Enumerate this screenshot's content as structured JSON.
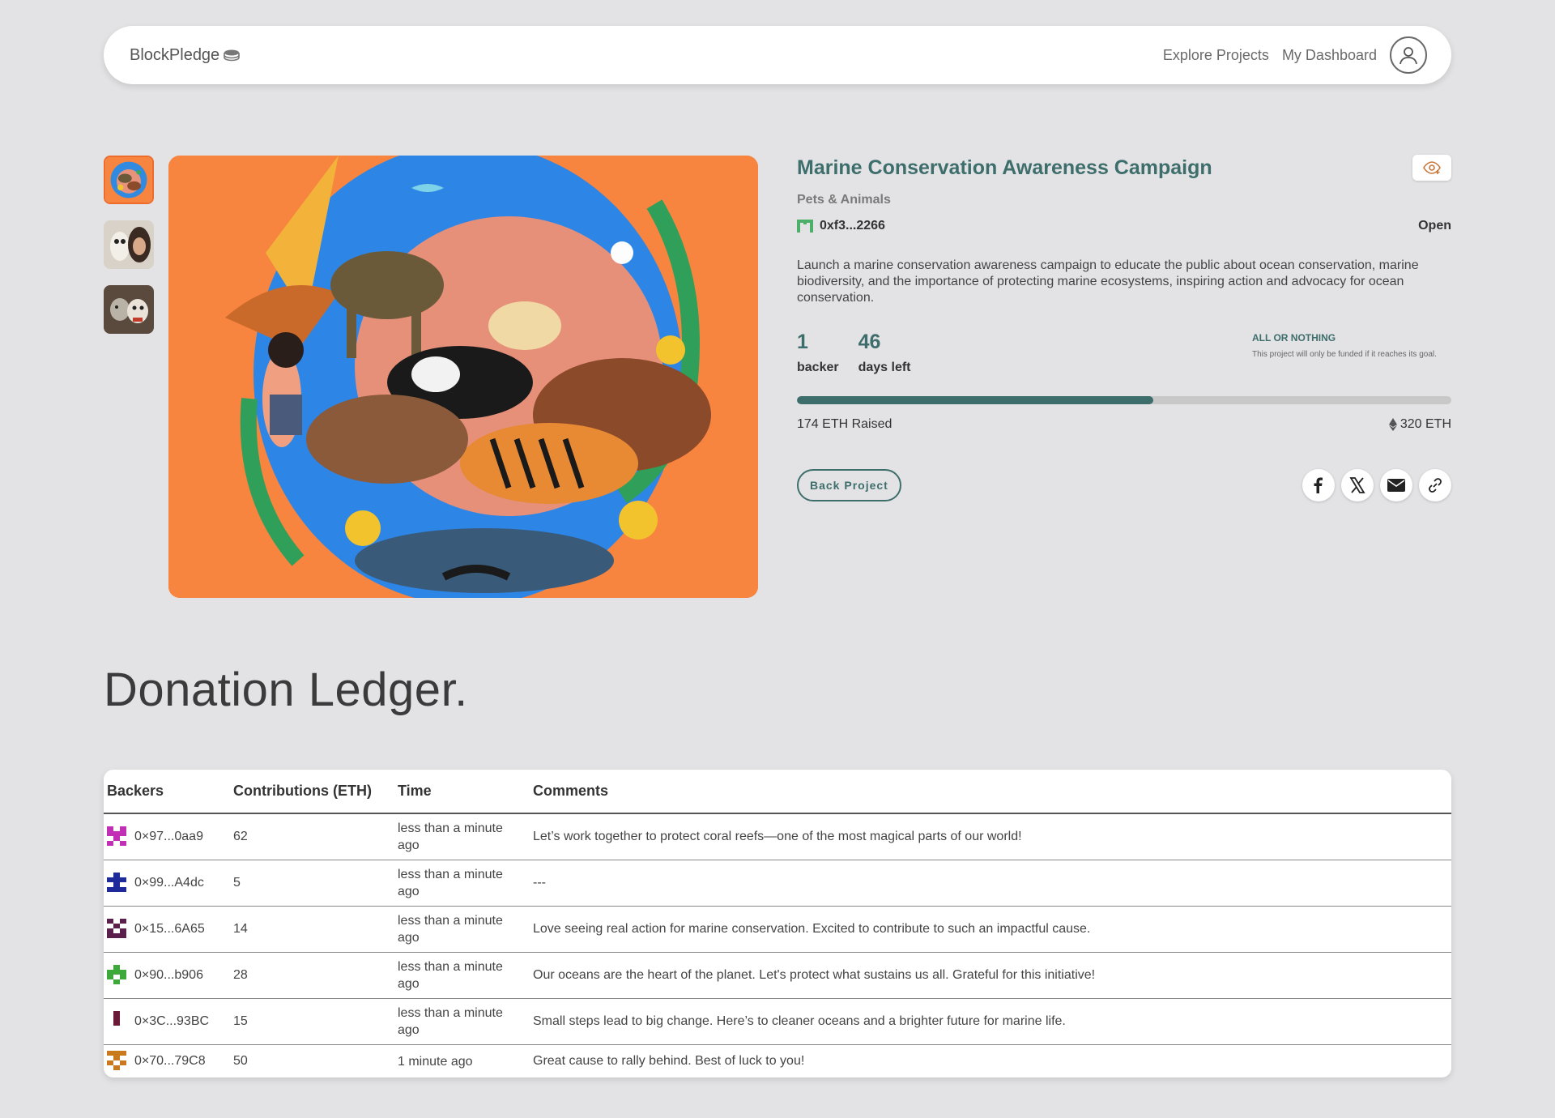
{
  "nav": {
    "brand": "BlockPledge",
    "links": [
      "Explore Projects",
      "My Dashboard"
    ]
  },
  "project": {
    "title": "Marine Conservation Awareness Campaign",
    "category": "Pets & Animals",
    "owner": "0xf3...2266",
    "status": "Open",
    "description": "Launch a marine conservation awareness campaign to educate the public about ocean conservation, marine biodiversity, and the importance of protecting marine ecosystems, inspiring action and advocacy for ocean conservation.",
    "backers_count": "1",
    "backers_label": "backer",
    "days_left": "46",
    "days_left_label": "days left",
    "funding_model_title": "ALL OR NOTHING",
    "funding_model_text": "This project will only be funded if it reaches its goal.",
    "raised_text": "174 ETH Raised",
    "goal_text": "320 ETH",
    "progress_fraction": 0.544,
    "back_button": "Back Project"
  },
  "ledger": {
    "heading": "Donation Ledger.",
    "columns": [
      "Backers",
      "Contributions (ETH)",
      "Time",
      "Comments"
    ],
    "rows": [
      {
        "backer": "0×97...0aa9",
        "amount": "62",
        "time": "less than a minute ago",
        "comment": "Let’s work together to protect coral reefs—one of the most magical parts of our world!",
        "color": "#c02fb4"
      },
      {
        "backer": "0×99...A4dc",
        "amount": "5",
        "time": "less than a minute ago",
        "comment": "---",
        "color": "#1f2a9a"
      },
      {
        "backer": "0×15...6A65",
        "amount": "14",
        "time": "less than a minute ago",
        "comment": "Love seeing real action for marine conservation. Excited to contribute to such an impactful cause.",
        "color": "#5a1f4a"
      },
      {
        "backer": "0×90...b906",
        "amount": "28",
        "time": "less than a minute ago",
        "comment": "Our oceans are the heart of the planet. Let's protect what sustains us all. Grateful for this initiative!",
        "color": "#3fa83a"
      },
      {
        "backer": "0×3C...93BC",
        "amount": "15",
        "time": "less than a minute ago",
        "comment": "Small steps lead to big change. Here’s to cleaner oceans and a brighter future for marine life.",
        "color": "#6a1a36"
      },
      {
        "backer": "0×70...79C8",
        "amount": "50",
        "time": "1 minute ago",
        "comment": "Great cause to rally behind. Best of luck to you!",
        "color": "#c97a1d"
      }
    ]
  },
  "colors": {
    "accent": "#3e6e6c",
    "background": "#e3e3e5",
    "hero_bg": "#f7843f",
    "thumb_active_border": "#ef6b2a"
  },
  "icons": [
    "coin-stack-icon",
    "user-circle-icon",
    "eye-plus-icon",
    "owner-identicon",
    "ethereum-icon",
    "facebook-icon",
    "x-icon",
    "email-icon",
    "link-icon"
  ]
}
